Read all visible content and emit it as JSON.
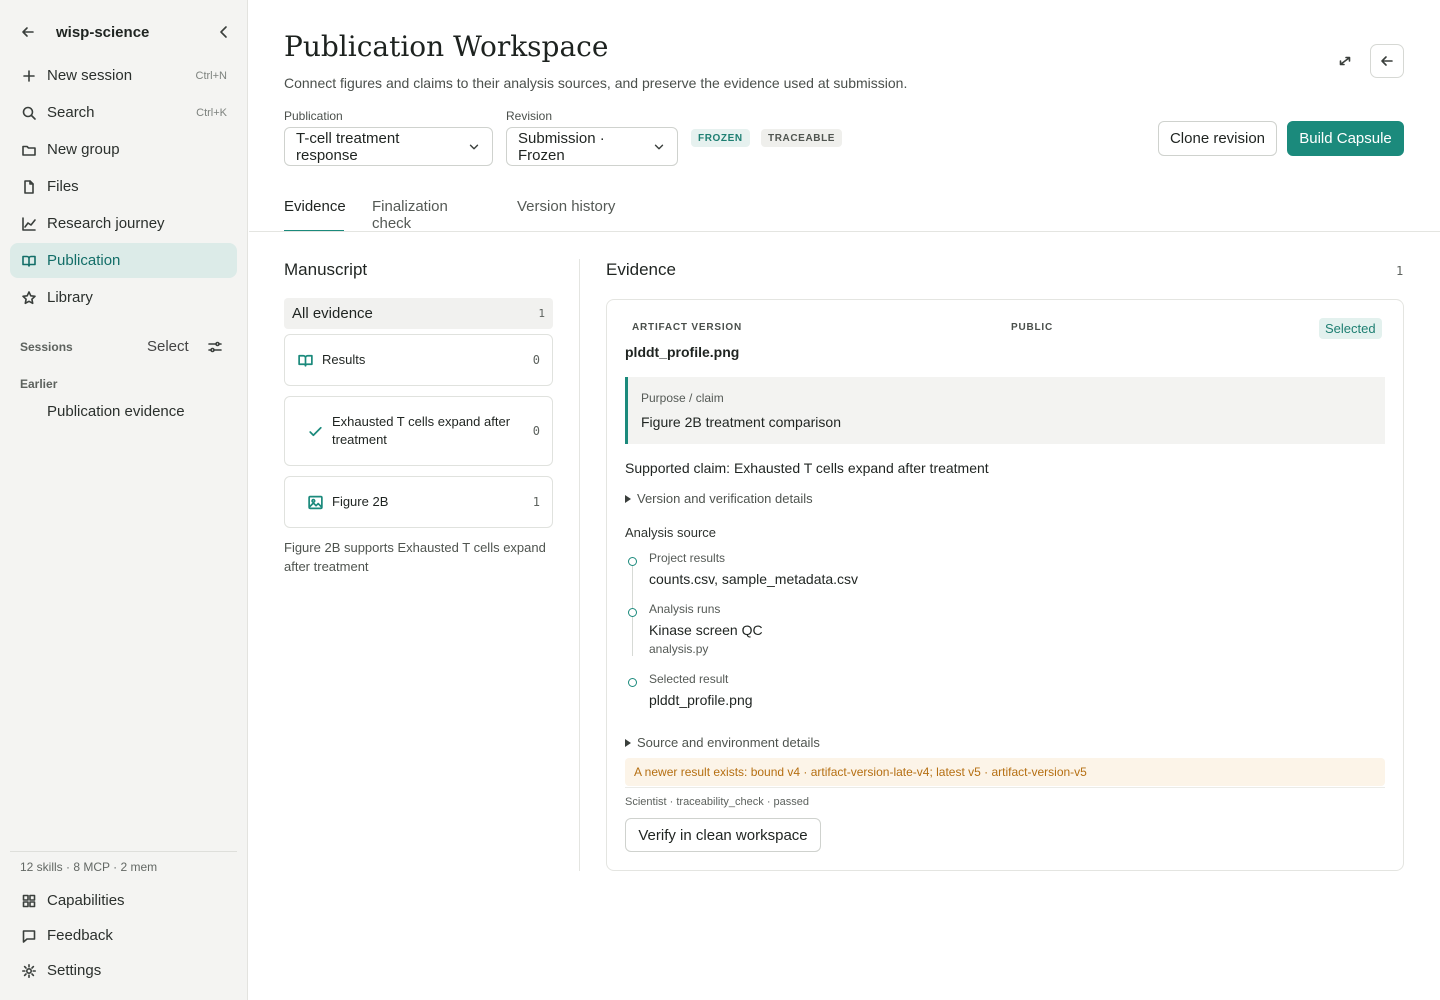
{
  "sidebar": {
    "brand": "wisp-science",
    "nav": [
      {
        "label": "New session",
        "shortcut": "Ctrl+N",
        "icon": "plus-icon"
      },
      {
        "label": "Search",
        "shortcut": "Ctrl+K",
        "icon": "search-icon"
      },
      {
        "label": "New group",
        "icon": "folder-icon"
      },
      {
        "label": "Files",
        "icon": "file-icon"
      },
      {
        "label": "Research journey",
        "icon": "chart-line-icon"
      },
      {
        "label": "Publication",
        "icon": "book-open-icon",
        "active": true
      },
      {
        "label": "Library",
        "icon": "star-icon"
      }
    ],
    "sessions_label": "Sessions",
    "select_label": "Select",
    "earlier_label": "Earlier",
    "sessions": [
      "Publication evidence"
    ],
    "counts": "12 skills · 8 MCP · 2 mem",
    "footer": [
      {
        "label": "Capabilities",
        "icon": "grid-icon"
      },
      {
        "label": "Feedback",
        "icon": "message-icon"
      },
      {
        "label": "Settings",
        "icon": "gear-icon"
      }
    ]
  },
  "header": {
    "title": "Publication Workspace",
    "subtitle": "Connect figures and claims to their analysis sources, and preserve the evidence used at submission.",
    "publication_label": "Publication",
    "publication_value": "T-cell treatment response",
    "revision_label": "Revision",
    "revision_value": "Submission · Frozen",
    "badges": [
      "FROZEN",
      "TRACEABLE"
    ],
    "clone_label": "Clone revision",
    "build_label": "Build Capsule"
  },
  "tabs": [
    "Evidence",
    "Finalization check",
    "Version history"
  ],
  "manuscript": {
    "title": "Manuscript",
    "all_evidence": {
      "label": "All evidence",
      "count": "1"
    },
    "items": [
      {
        "label": "Results",
        "count": "0",
        "icon": "book-open-icon"
      },
      {
        "label": "Exhausted T cells expand after treatment",
        "count": "0",
        "icon": "check-icon"
      },
      {
        "label": "Figure 2B",
        "count": "1",
        "icon": "image-icon"
      }
    ],
    "note": "Figure 2B supports Exhausted T cells expand after treatment"
  },
  "evidence": {
    "title": "Evidence",
    "count": "1",
    "card": {
      "eyebrow": "ARTIFACT VERSION",
      "visibility": "PUBLIC",
      "selected": "Selected",
      "name": "plddt_profile.png",
      "purpose_label": "Purpose / claim",
      "purpose_value": "Figure 2B treatment comparison",
      "claim": "Supported claim: Exhausted T cells expand after treatment",
      "version_details": "Version and verification details",
      "analysis_title": "Analysis source",
      "timeline": [
        {
          "label": "Project results",
          "value": "counts.csv, sample_metadata.csv",
          "sub": ""
        },
        {
          "label": "Analysis runs",
          "value": "Kinase screen QC",
          "sub": "analysis.py"
        },
        {
          "label": "Selected result",
          "value": "plddt_profile.png",
          "sub": ""
        }
      ],
      "env_details": "Source and environment details",
      "warning": "A newer result exists: bound v4 · artifact-version-late-v4; latest v5 · artifact-version-v5",
      "meta": "Scientist · traceability_check · passed",
      "verify_label": "Verify in clean workspace"
    }
  },
  "colors": {
    "accent": "#1b8a7c",
    "active_bg": "#dcebe8",
    "warning": "#b56f12",
    "warning_bg": "#fcf4e8"
  }
}
